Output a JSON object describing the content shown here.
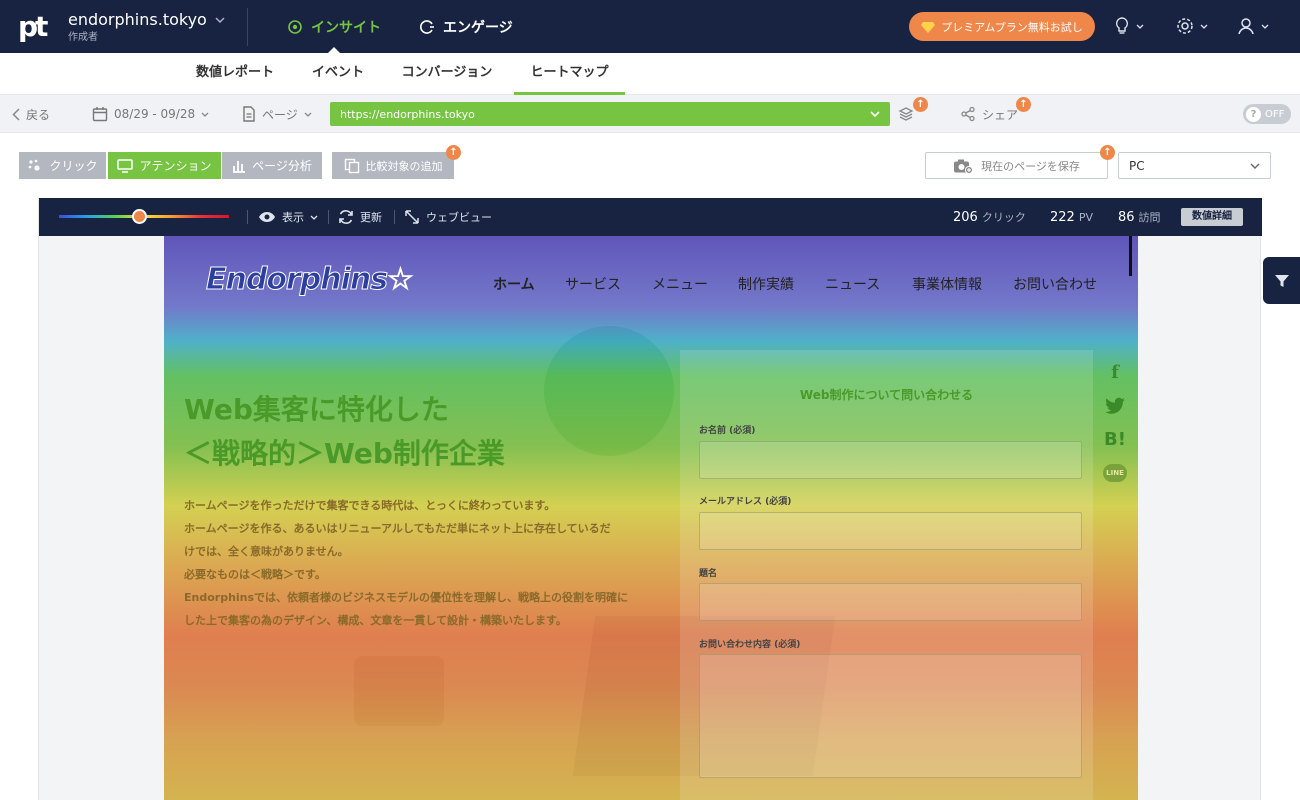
{
  "app": {
    "logo_text": "pt",
    "site_name": "endorphins.tokyo",
    "site_role": "作成者",
    "nav": [
      {
        "label": "インサイト",
        "icon": "gear-eye-icon"
      },
      {
        "label": "エンゲージ",
        "icon": "engage-icon"
      }
    ],
    "premium_label": "プレミアムプラン無料お試し"
  },
  "subnav": {
    "tabs": [
      "数値レポート",
      "イベント",
      "コンバージョン",
      "ヒートマップ"
    ],
    "active": "ヒートマップ"
  },
  "filterbar": {
    "back_label": "戻る",
    "date_range": "08/29 - 09/28",
    "page_label": "ページ",
    "url": "https://endorphins.tokyo",
    "share_label": "シェア",
    "toggle_label": "OFF",
    "toggle_icon_text": "?"
  },
  "modes": {
    "click": "クリック",
    "attention": "アテンション",
    "page_analysis": "ページ分析",
    "add_compare": "比較対象の追加",
    "save_page": "現在のページを保存",
    "device": "PC"
  },
  "viewer": {
    "display_label": "表示",
    "refresh_label": "更新",
    "webview_label": "ウェブビュー",
    "clicks_value": "206",
    "clicks_label": "クリック",
    "pv_value": "222",
    "pv_label": "PV",
    "visits_value": "86",
    "visits_label": "訪問",
    "detail_label": "数値詳細",
    "attention_level": 0.47
  },
  "site_preview": {
    "logo": "Endorphins☆",
    "nav": [
      "ホーム",
      "サービス",
      "メニュー",
      "制作実績",
      "ニュース",
      "事業体情報",
      "お問い合わせ"
    ],
    "hero_title_1": "Web集客に特化した",
    "hero_title_2": "＜戦略的＞Web制作企業",
    "hero_lines": [
      "ホームページを作っただけで集客できる時代は、とっくに終わっています。",
      "ホームページを作る、あるいはリニューアルしてもただ単にネット上に存在しているだ",
      "けでは、全く意味がありません。",
      "必要なものは＜戦略＞です。",
      "Endorphinsでは、依頼者様のビジネスモデルの優位性を理解し、戦略上の役割を明確に",
      "した上で集客の為のデザイン、構成、文章を一貫して設計・構築いたします。"
    ],
    "form_title": "Web制作について問い合わせる",
    "form_name": "お名前 (必須)",
    "form_email": "メールアドレス (必須)",
    "form_subject": "題名",
    "form_message": "お問い合わせ内容 (必須)",
    "share_hatena": "B!",
    "share_line": "LINE"
  },
  "colors": {
    "navy": "#172340",
    "green": "#76c442",
    "orange": "#f0874a"
  }
}
